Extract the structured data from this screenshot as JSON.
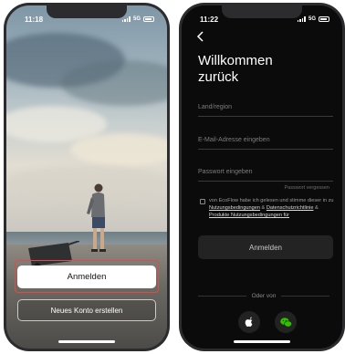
{
  "left_phone": {
    "status": {
      "time": "11:18",
      "network": "5G"
    },
    "login_label": "Anmelden",
    "register_label": "Neues Konto erstellen"
  },
  "right_phone": {
    "status": {
      "time": "11:22",
      "network": "5G"
    },
    "title_line1": "Willkommen",
    "title_line2": "zurück",
    "fields": {
      "region_placeholder": "Land/region",
      "email_placeholder": "E-Mail-Adresse eingeben",
      "password_placeholder": "Passwort eingeben"
    },
    "forgot_password": "Passwort vergessen",
    "terms": {
      "prefix": "von EcoFlow habe ich gelesen und stimme dieser in zu ",
      "link1": "Nutzungsbedingungen",
      "sep1": " & ",
      "link2": "Datenschutzrichtlinie",
      "sep2": " & ",
      "link3": "Produkte Nutzungsbedingungen für",
      "checked": false
    },
    "submit_label": "Anmelden",
    "or_label": "Oder von",
    "social": [
      "apple-icon",
      "wechat-icon"
    ]
  },
  "colors": {
    "highlight": "#e04a4a",
    "dark_bg": "#0b0b0b",
    "button_dark": "#232323"
  }
}
